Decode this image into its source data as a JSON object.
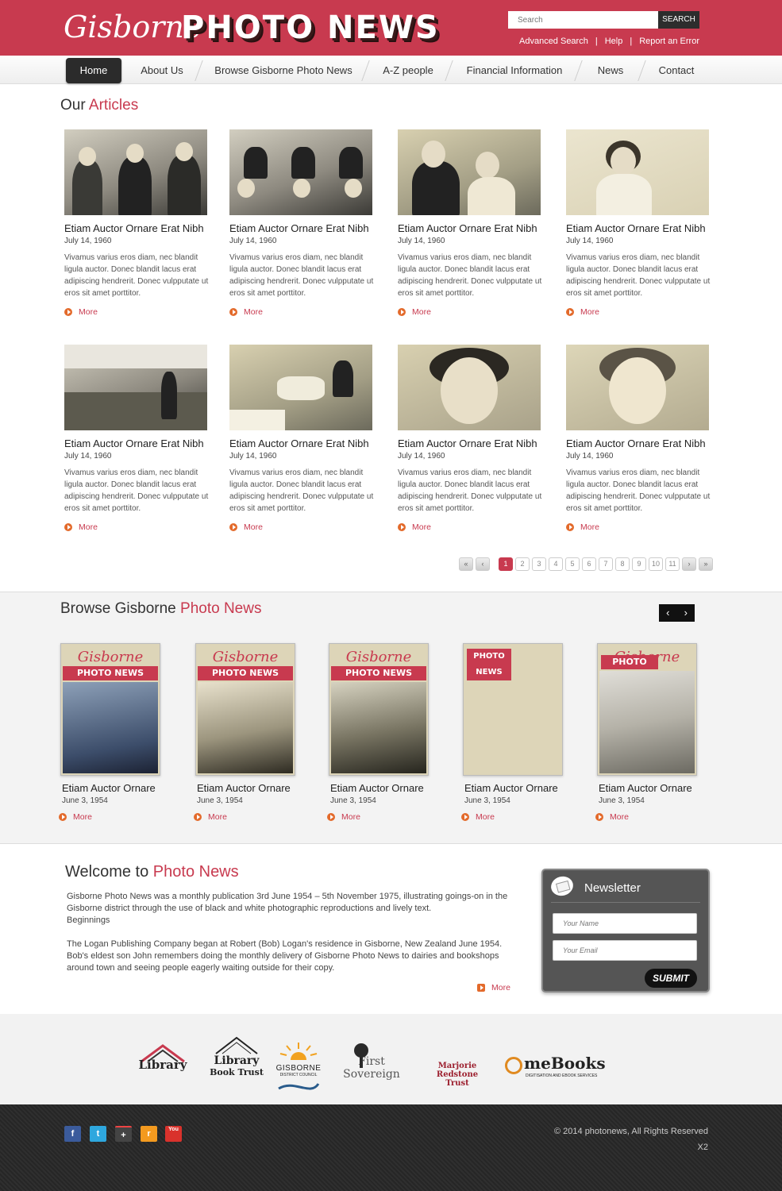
{
  "header": {
    "logo_script": "Gisborne",
    "logo_block": "PHOTO NEWS",
    "search_placeholder": "Search",
    "search_button": "SEARCH",
    "links": [
      "Advanced Search",
      "Help",
      "Report an Error"
    ],
    "brand_color": "#c83a4f"
  },
  "nav": {
    "items": [
      "Home",
      "About Us",
      "Browse Gisborne Photo News",
      "A-Z people",
      "Financial Information",
      "News",
      "Contact"
    ],
    "active": "Home"
  },
  "articles": {
    "title_plain": "Our",
    "title_highlight": "Articles",
    "items": [
      {
        "title": "Etiam Auctor Ornare Erat Nibh",
        "date": "July 14, 1960",
        "desc": "Vivamus varius eros diam, nec blandit ligula auctor. Donec blandit lacus erat adipiscing hendrerit. Donec vulpputate ut eros sit amet porttitor.",
        "more": "More"
      },
      {
        "title": "Etiam Auctor Ornare Erat Nibh",
        "date": "July 14, 1960",
        "desc": "Vivamus varius eros diam, nec blandit ligula auctor. Donec blandit lacus erat adipiscing hendrerit. Donec vulpputate ut eros sit amet porttitor.",
        "more": "More"
      },
      {
        "title": "Etiam Auctor Ornare Erat Nibh",
        "date": "July 14, 1960",
        "desc": "Vivamus varius eros diam, nec blandit ligula auctor. Donec blandit lacus erat adipiscing hendrerit. Donec vulpputate ut eros sit amet porttitor.",
        "more": "More"
      },
      {
        "title": "Etiam Auctor Ornare Erat Nibh",
        "date": "July 14, 1960",
        "desc": "Vivamus varius eros diam, nec blandit ligula auctor. Donec blandit lacus erat adipiscing hendrerit. Donec vulpputate ut eros sit amet porttitor.",
        "more": "More"
      },
      {
        "title": "Etiam Auctor Ornare Erat Nibh",
        "date": "July 14, 1960",
        "desc": "Vivamus varius eros diam, nec blandit ligula auctor. Donec blandit lacus erat adipiscing hendrerit. Donec vulpputate ut eros sit amet porttitor.",
        "more": "More"
      },
      {
        "title": "Etiam Auctor Ornare Erat Nibh",
        "date": "July 14, 1960",
        "desc": "Vivamus varius eros diam, nec blandit ligula auctor. Donec blandit lacus erat adipiscing hendrerit. Donec vulpputate ut eros sit amet porttitor.",
        "more": "More"
      },
      {
        "title": "Etiam Auctor Ornare Erat Nibh",
        "date": "July 14, 1960",
        "desc": "Vivamus varius eros diam, nec blandit ligula auctor. Donec blandit lacus erat adipiscing hendrerit. Donec vulpputate ut eros sit amet porttitor.",
        "more": "More"
      },
      {
        "title": "Etiam Auctor Ornare Erat Nibh",
        "date": "July 14, 1960",
        "desc": "Vivamus varius eros diam, nec blandit ligula auctor. Donec blandit lacus erat adipiscing hendrerit. Donec vulpputate ut eros sit amet porttitor.",
        "more": "More"
      }
    ]
  },
  "pagination": {
    "pages": [
      "1",
      "2",
      "3",
      "4",
      "5",
      "6",
      "7",
      "8",
      "9",
      "10",
      "11"
    ],
    "current": "1"
  },
  "browse": {
    "title_plain": "Browse Gisborne",
    "title_highlight": "Photo News",
    "cover_script": "Gisborne",
    "cover_band": "PHOTO NEWS",
    "items": [
      {
        "title": "Etiam Auctor Ornare",
        "date": "June 3, 1954",
        "more": "More"
      },
      {
        "title": "Etiam Auctor Ornare",
        "date": "June 3, 1954",
        "more": "More"
      },
      {
        "title": "Etiam Auctor Ornare",
        "date": "June 3, 1954",
        "more": "More"
      },
      {
        "title": "Etiam Auctor Ornare",
        "date": "June 3, 1954",
        "more": "More"
      },
      {
        "title": "Etiam Auctor Ornare",
        "date": "June 3, 1954",
        "more": "More"
      }
    ]
  },
  "welcome": {
    "title_plain": "Welcome to",
    "title_highlight": "Photo News",
    "p1": "Gisborne Photo News was a monthly publication 3rd June 1954 – 5th November 1975, illustrating goings-on in the Gisborne district through the use of black and white photographic reproductions and lively text.",
    "p1b": "Beginnings",
    "p2": "The Logan Publishing Company began at Robert (Bob) Logan's residence in Gisborne, New Zealand June 1954. Bob's eldest son John remembers doing the monthly delivery of Gisborne Photo News to dairies and bookshops around town and seeing people eagerly waiting outside for their copy.",
    "more": "More"
  },
  "newsletter": {
    "title": "Newsletter",
    "name_placeholder": "Your Name",
    "email_placeholder": "Your Email",
    "submit": "SUBMIT"
  },
  "sponsors": {
    "library1": "Library",
    "library2_top": "Library",
    "library2_bottom": "Book Trust",
    "gisborne": "GISBORNE",
    "gisborne_sub": "DISTRICT COUNCIL",
    "first_sovereign": "First Sovereign",
    "marjorie1": "Marjorie Redstone",
    "marjorie2": "Trust",
    "mebooks": "meBooks",
    "mebooks_sub": "DIGITISATION AND EBOOK SERVICES"
  },
  "footer": {
    "copyright": "© 2014 photonews, All Rights Reserved",
    "x2": "X2",
    "social": [
      {
        "icon": "facebook-icon",
        "glyph": "f",
        "color": "#3b5b9c"
      },
      {
        "icon": "twitter-icon",
        "glyph": "t",
        "color": "#2ea7de"
      },
      {
        "icon": "google-plus-icon",
        "glyph": "+",
        "color": "#444444"
      },
      {
        "icon": "rss-icon",
        "glyph": "r",
        "color": "#f39a1f"
      },
      {
        "icon": "youtube-icon",
        "glyph": "You",
        "color": "#d9322c"
      }
    ]
  }
}
